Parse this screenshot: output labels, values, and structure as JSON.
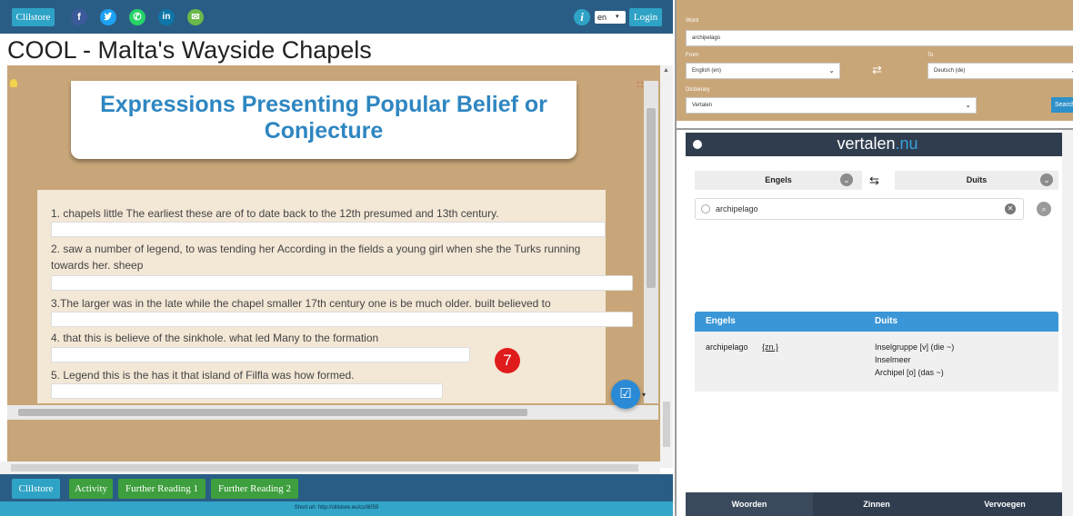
{
  "header": {
    "cliltstore_label": "Clilstore",
    "info_icon": "i",
    "language": "en",
    "login_label": "Login",
    "social": [
      {
        "name": "facebook-icon",
        "glyph": "f",
        "color": "#3b5998"
      },
      {
        "name": "twitter-icon",
        "glyph": "t",
        "color": "#1da1f2"
      },
      {
        "name": "whatsapp-icon",
        "glyph": "✆",
        "color": "#25d366"
      },
      {
        "name": "linkedin-icon",
        "glyph": "in",
        "color": "#0e76a8"
      },
      {
        "name": "email-icon",
        "glyph": "✉",
        "color": "#6cb84b"
      }
    ]
  },
  "page_title": "COOL - Malta's Wayside Chapels",
  "lesson": {
    "card_title": "Expressions Presenting Popular Belief or Conjecture",
    "questions": [
      "1. chapels little The earliest these are of to date back to the 12th presumed and 13th century.",
      "2. saw a number of legend, to was tending her According in the fields a young girl when she the Turks running towards her. sheep",
      "3.The larger was in the late while the chapel smaller 17th century one is be much older. built believed to",
      "4. that this is believe of the sinkhole. what led Many to the formation",
      "5. Legend this is the has it that island of Filfla was how formed."
    ],
    "badge": "7",
    "fab_icon": "check-icon"
  },
  "footer": {
    "buttons": [
      "Clilstore",
      "Activity",
      "Further Reading 1",
      "Further Reading 2"
    ],
    "short_url": "Short url:  http://clilstore.eu/cs/8059"
  },
  "dictionary": {
    "word_label": "Word",
    "word_value": "archipelago",
    "from_label": "From",
    "from_value": "English (en)",
    "to_label": "To",
    "to_value": "Deutsch (de)",
    "dict_label": "Dictionary",
    "dict_value": "Vertalen",
    "search_label": "Search"
  },
  "vertalen": {
    "logo_main": "vertalen",
    "logo_suffix": ".nu",
    "source_lang": "Engels",
    "target_lang": "Duits",
    "search_value": "archipelago",
    "results": {
      "col_source": "Engels",
      "col_target": "Duits",
      "term": "archipelago",
      "pos": "{zn.}",
      "translations": [
        "Inselgruppe [v] (die ~)",
        "Inselmeer",
        "Archipel [o] (das ~)"
      ]
    },
    "tabs": [
      "Woorden",
      "Zinnen",
      "Vervoegen"
    ]
  }
}
